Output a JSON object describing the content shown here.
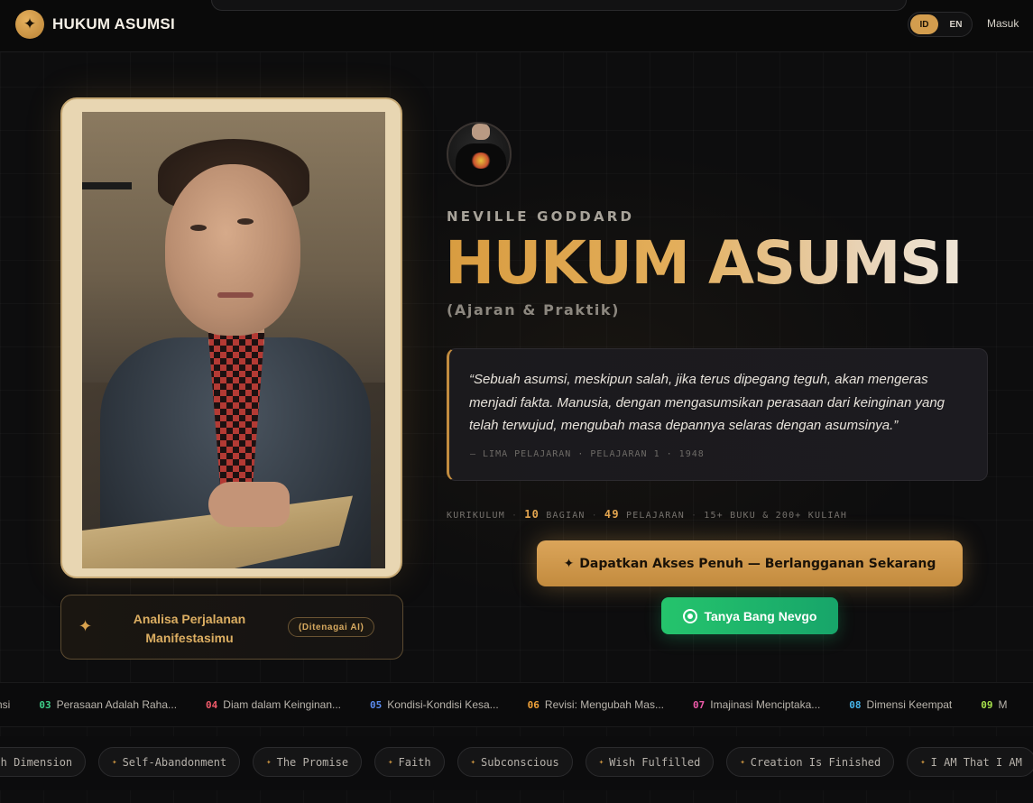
{
  "header": {
    "brand_name": "HUKUM ASUMSI",
    "brand_icon": "sparkle-icon",
    "languages": [
      {
        "code": "ID",
        "active": true
      },
      {
        "code": "EN",
        "active": false
      }
    ],
    "login_label": "Masuk"
  },
  "hero": {
    "eyebrow": "NEVILLE GODDARD",
    "title": "HUKUM ASUMSI",
    "subtitle": "(Ajaran & Praktik)",
    "quote": "“Sebuah asumsi, meskipun salah, jika terus dipegang teguh, akan mengeras menjadi fakta. Manusia, dengan mengasumsikan perasaan dari keinginan yang telah terwujud, mengubah masa depannya selaras dengan asumsinya.”",
    "quote_source": "— LIMA PELAJARAN · PELAJARAN 1 · 1948",
    "stats": {
      "label": "KURIKULUM",
      "sections_count": "10",
      "sections_label": "BAGIAN",
      "lessons_count": "49",
      "lessons_label": "PELAJARAN",
      "extra": "15+ BUKU & 200+ KULIAH"
    },
    "cta_icon": "✦",
    "cta_label": "Dapatkan Akses Penuh — Berlangganan Sekarang",
    "whatsapp_label": "Tanya Bang Nevgo"
  },
  "analisa": {
    "label": "Analisa Perjalanan Manifestasimu",
    "badge": "(Ditenagai AI)"
  },
  "lessons": [
    {
      "num": "",
      "title": "umsi",
      "color": "#b9b4ac"
    },
    {
      "num": "03",
      "title": "Perasaan Adalah Raha...",
      "color": "#3fd08a"
    },
    {
      "num": "04",
      "title": "Diam dalam Keinginan...",
      "color": "#ef5a6a"
    },
    {
      "num": "05",
      "title": "Kondisi-Kondisi Kesa...",
      "color": "#5b8cf0"
    },
    {
      "num": "06",
      "title": "Revisi: Mengubah Mas...",
      "color": "#f0a23a"
    },
    {
      "num": "07",
      "title": "Imajinasi Menciptaka...",
      "color": "#ec5aa8"
    },
    {
      "num": "08",
      "title": "Dimensi Keempat",
      "color": "#46b5ea"
    },
    {
      "num": "09",
      "title": "M",
      "color": "#a6e04b"
    }
  ],
  "tags": [
    "urth Dimension",
    "Self-Abandonment",
    "The Promise",
    "Faith",
    "Subconscious",
    "Wish Fulfilled",
    "Creation Is Finished",
    "I AM That I AM"
  ]
}
